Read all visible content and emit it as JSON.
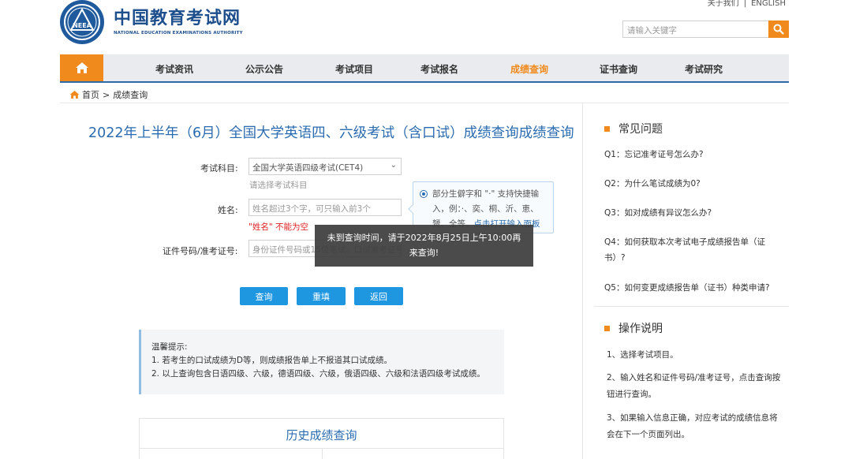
{
  "header": {
    "logo_cn": "中国教育考试网",
    "logo_en": "NATIONAL EDUCATION EXAMINATIONS AUTHORITY",
    "logo_mark": "NEEA",
    "top_links": [
      "关于我们",
      "|",
      "ENGLISH"
    ],
    "search_placeholder": "请输入关键字"
  },
  "nav": {
    "items": [
      "考试资讯",
      "公示公告",
      "考试项目",
      "考试报名",
      "成绩查询",
      "证书查询",
      "考试研究"
    ],
    "active": "成绩查询"
  },
  "breadcrumb": {
    "home": "首页",
    "sep": ">",
    "current": "成绩查询"
  },
  "main": {
    "title": "2022年上半年（6月）全国大学英语四、六级考试（含口试）成绩查询成绩查询",
    "subject_label": "考试科目:",
    "subject_value": "全国大学英语四级考试(CET4)",
    "subject_hint": "请选择考试科目",
    "name_label": "姓名:",
    "name_placeholder": "姓名超过3个字，可只输入前3个",
    "name_error": "\"姓名\" 不能为空",
    "id_label": "证件号码/准考证号:",
    "id_placeholder": "身份证件号码或15位笔试、口试准考证号",
    "tip_line1": "部分生僻字和 \"·\" 支持快捷输",
    "tip_line2": "入，例：·、奕、桐、沂、恵、",
    "tip_line3_a": "赟、全等。",
    "tip_line3_link": "点击打开输入面板",
    "toast_line1": "未到查询时间，请于2022年8月25日上午10:00再",
    "toast_line2": "来查询!",
    "buttons": {
      "query": "查询",
      "reset": "重填",
      "back": "返回"
    },
    "notice": {
      "title": "温馨提示:",
      "line1": "1. 若考生的口试成绩为D等，则成绩报告单上不报道其口试成绩。",
      "line2": "2. 以上查询包含日语四级、六级，德语四级、六级，俄语四级、六级和法语四级考试成绩。"
    },
    "history_title": "历史成绩查询"
  },
  "faq": {
    "title": "常见问题",
    "q1": "Q1：忘记准考证号怎么办?",
    "q2": "Q2：为什么笔试成绩为0?",
    "q3": "Q3：如对成绩有异议怎么办?",
    "q4a": "Q4：如何获取本次考试电子成绩报告单（证",
    "q4b": "书）?",
    "q5": "Q5：如何变更成绩报告单（证书）种类申请?"
  },
  "ops": {
    "title": "操作说明",
    "s1": "1、选择考试项目。",
    "s2a": "2、输入姓名和证件号码/准考证号，点击查询按",
    "s2b": "钮进行查询。",
    "s3a": "3、如果输入信息正确，对应考试的成绩信息将",
    "s3b": "会在下一个页面列出。"
  },
  "colors": {
    "accent": "#f08a1c",
    "brand": "#1e4f8d",
    "link": "#2b6cb0",
    "button": "#1e96e0",
    "error": "#dd2222"
  }
}
